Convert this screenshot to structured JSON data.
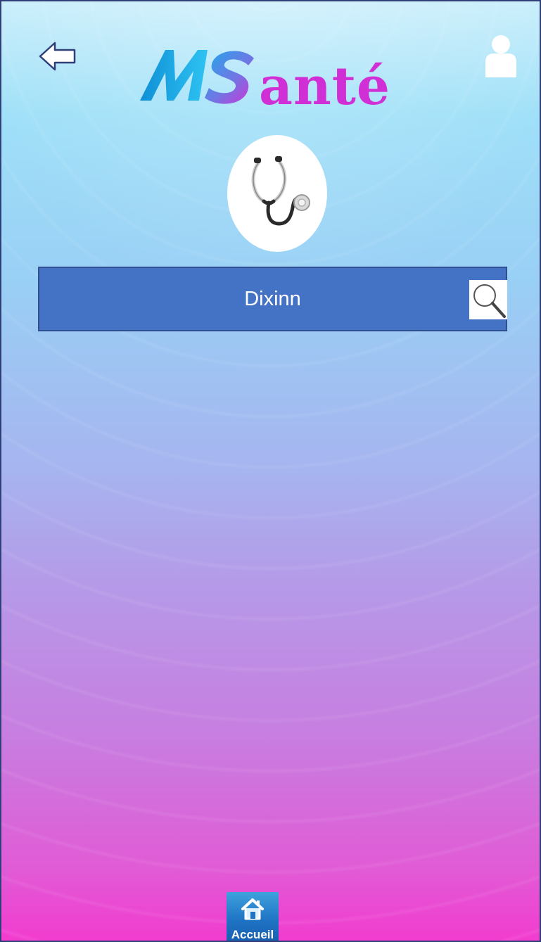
{
  "app": {
    "logo_text": "anté"
  },
  "header": {
    "back_icon": "left-arrow-icon",
    "profile_icon": "user-icon"
  },
  "hero": {
    "icon": "stethoscope-icon"
  },
  "search": {
    "value": "Dixinn",
    "icon": "search-icon"
  },
  "bottom_nav": {
    "home_label": "Accueil",
    "home_icon": "home-icon"
  },
  "colors": {
    "search_bar": "#4472c4",
    "logo_magenta": "#d12fd6",
    "logo_blue": "#1da9e6",
    "home_button": "#1f73c4"
  }
}
